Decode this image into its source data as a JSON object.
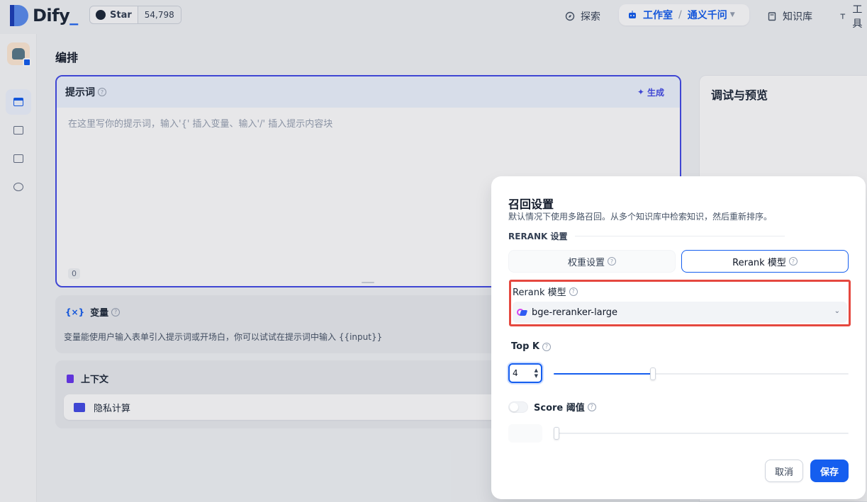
{
  "nav": {
    "brand": "Dify",
    "star_label": "Star",
    "star_count": "54,798",
    "explore": "探索",
    "studio": "工作室",
    "studio_model": "通义千问",
    "knowledge": "知识库",
    "tools": "工具"
  },
  "main": {
    "title": "编排",
    "prompt": {
      "title": "提示词",
      "generate": "生成",
      "placeholder": "在这里写你的提示词，输入'{' 插入变量、输入'/' 插入提示内容块",
      "count": "0"
    },
    "variables": {
      "title": "变量",
      "description": "变量能使用户输入表单引入提示词或开场白，你可以试试在提示词中输入 {{input}}"
    },
    "context": {
      "title": "上下文",
      "item": "隐私计算"
    },
    "preview": {
      "title": "调试与预览"
    }
  },
  "modal": {
    "title": "召回设置",
    "subtitle": "默认情况下使用多路召回。从多个知识库中检索知识，然后重新排序。",
    "section": "RERANK 设置",
    "tab_weight": "权重设置",
    "tab_rerank": "Rerank 模型",
    "rerank_label": "Rerank 模型",
    "rerank_model": "bge-reranker-large",
    "topk_label": "Top K",
    "topk_value": "4",
    "score_label": "Score 阈值",
    "score_enabled": false,
    "cancel": "取消",
    "save": "保存"
  },
  "colors": {
    "accent": "#155eef",
    "prompt_border": "#444ce7",
    "highlight": "#e5483f"
  }
}
